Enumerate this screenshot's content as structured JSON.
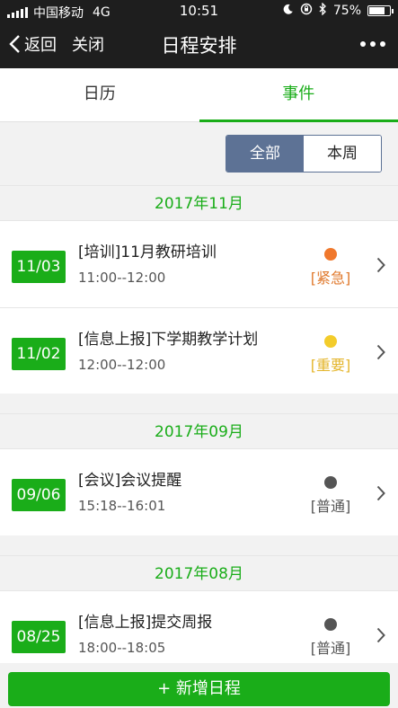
{
  "status": {
    "carrier": "中国移动",
    "network": "4G",
    "time": "10:51",
    "battery": "75%",
    "battery_level": 0.75,
    "icons": [
      "moon-icon",
      "lock-rotation-icon",
      "bluetooth-icon",
      "battery-icon"
    ]
  },
  "nav": {
    "back": "返回",
    "close": "关闭",
    "title": "日程安排"
  },
  "tabs": [
    {
      "label": "日历"
    },
    {
      "label": "事件"
    }
  ],
  "filter": {
    "all": "全部",
    "week": "本周"
  },
  "colors": {
    "accent": "#1aad19",
    "filter_active": "#5d7295",
    "urgent": "#f0782c",
    "important": "#f3cc2b",
    "normal": "#555555"
  },
  "groups": [
    {
      "month": "2017年11月",
      "events": [
        {
          "date": "11/03",
          "title": "[培训]11月教研培训",
          "time": "11:00--12:00",
          "priority": "[紧急]",
          "dot_color": "#f0782c",
          "label_color": "#e07a2e"
        },
        {
          "date": "11/02",
          "title": "[信息上报]下学期教学计划",
          "time": "12:00--12:00",
          "priority": "[重要]",
          "dot_color": "#f3cc2b",
          "label_color": "#e4b52b"
        }
      ]
    },
    {
      "month": "2017年09月",
      "events": [
        {
          "date": "09/06",
          "title": "[会议]会议提醒",
          "time": "15:18--16:01",
          "priority": "[普通]",
          "dot_color": "#555555",
          "label_color": "#555555"
        }
      ]
    },
    {
      "month": "2017年08月",
      "events": [
        {
          "date": "08/25",
          "title": "[信息上报]提交周报",
          "time": "18:00--18:05",
          "priority": "[普通]",
          "dot_color": "#555555",
          "label_color": "#555555"
        }
      ]
    }
  ],
  "add_button": "+ 新增日程"
}
